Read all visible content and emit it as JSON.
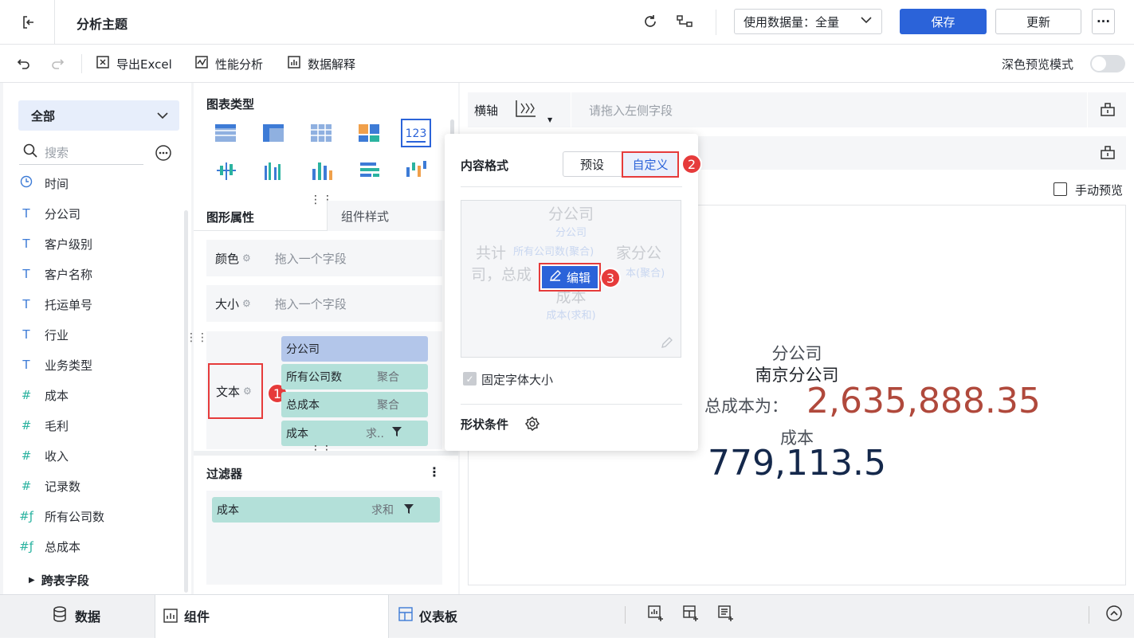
{
  "header": {
    "title": "分析主题",
    "data_usage_label": "使用数据量：全量",
    "save_label": "保存",
    "update_label": "更新",
    "more_label": "···"
  },
  "toolbar": {
    "export_excel": "导出Excel",
    "performance": "性能分析",
    "data_explain": "数据解释",
    "dark_preview": "深色预览模式"
  },
  "data_panel": {
    "dataset_select": "全部",
    "search_placeholder": "搜索",
    "fields": [
      {
        "label": "时间",
        "icon": "clock-icon"
      },
      {
        "label": "分公司",
        "icon": "text-type-icon"
      },
      {
        "label": "客户级别",
        "icon": "text-type-icon"
      },
      {
        "label": "客户名称",
        "icon": "text-type-icon"
      },
      {
        "label": "托运单号",
        "icon": "text-type-icon"
      },
      {
        "label": "行业",
        "icon": "text-type-icon"
      },
      {
        "label": "业务类型",
        "icon": "text-type-icon"
      },
      {
        "label": "成本",
        "icon": "number-type-icon"
      },
      {
        "label": "毛利",
        "icon": "number-type-icon"
      },
      {
        "label": "收入",
        "icon": "number-type-icon"
      },
      {
        "label": "记录数",
        "icon": "number-type-icon"
      },
      {
        "label": "所有公司数",
        "icon": "calc-field-icon"
      },
      {
        "label": "总成本",
        "icon": "calc-field-icon"
      }
    ],
    "cross_table": "跨表字段"
  },
  "config_panel": {
    "chart_type_title": "图表类型",
    "tab_graph_props": "图形属性",
    "tab_component_style": "组件样式",
    "color_label": "颜色",
    "size_label": "大小",
    "text_label": "文本",
    "drop_placeholder": "拖入一个字段",
    "text_fields": [
      {
        "label": "分公司",
        "tag": ""
      },
      {
        "label": "所有公司数",
        "tag": "聚合"
      },
      {
        "label": "总成本",
        "tag": "聚合"
      },
      {
        "label": "成本",
        "tag": "求.."
      }
    ],
    "filter_title": "过滤器",
    "filter_field": {
      "label": "成本",
      "tag": "求和"
    }
  },
  "axis": {
    "x_label": "横轴",
    "drop_hint": "请拖入左侧字段",
    "manual_preview": "手动预览"
  },
  "popover": {
    "title": "内容格式",
    "preset": "预设",
    "custom": "自定义",
    "preview_lines": [
      "分公司",
      "分公司",
      "共计",
      "所有公司数(聚合)",
      "家分公",
      "司，总成",
      "本(聚合)",
      "成本",
      "成本(求和)"
    ],
    "edit_label": "编辑",
    "fixed_font": "固定字体大小",
    "shape_condition": "形状条件"
  },
  "chart_text": {
    "label1": "分公司",
    "value1": "南京分公司",
    "sentence_fragment": "司，总成本为：",
    "big_value": "2,635,888.35",
    "label2": "成本",
    "value2": "779,113.5"
  },
  "badges": [
    "1",
    "2",
    "3"
  ],
  "bottom": {
    "data_tab": "数据",
    "component_tab": "组件",
    "dashboard_tab": "仪表板"
  },
  "colors": {
    "primary": "#2b63d9",
    "teal_pill": "#b3e0d9",
    "blue_pill": "#b3c6ea",
    "accent_red": "#b0493c",
    "badge_red": "#e63b3b"
  }
}
